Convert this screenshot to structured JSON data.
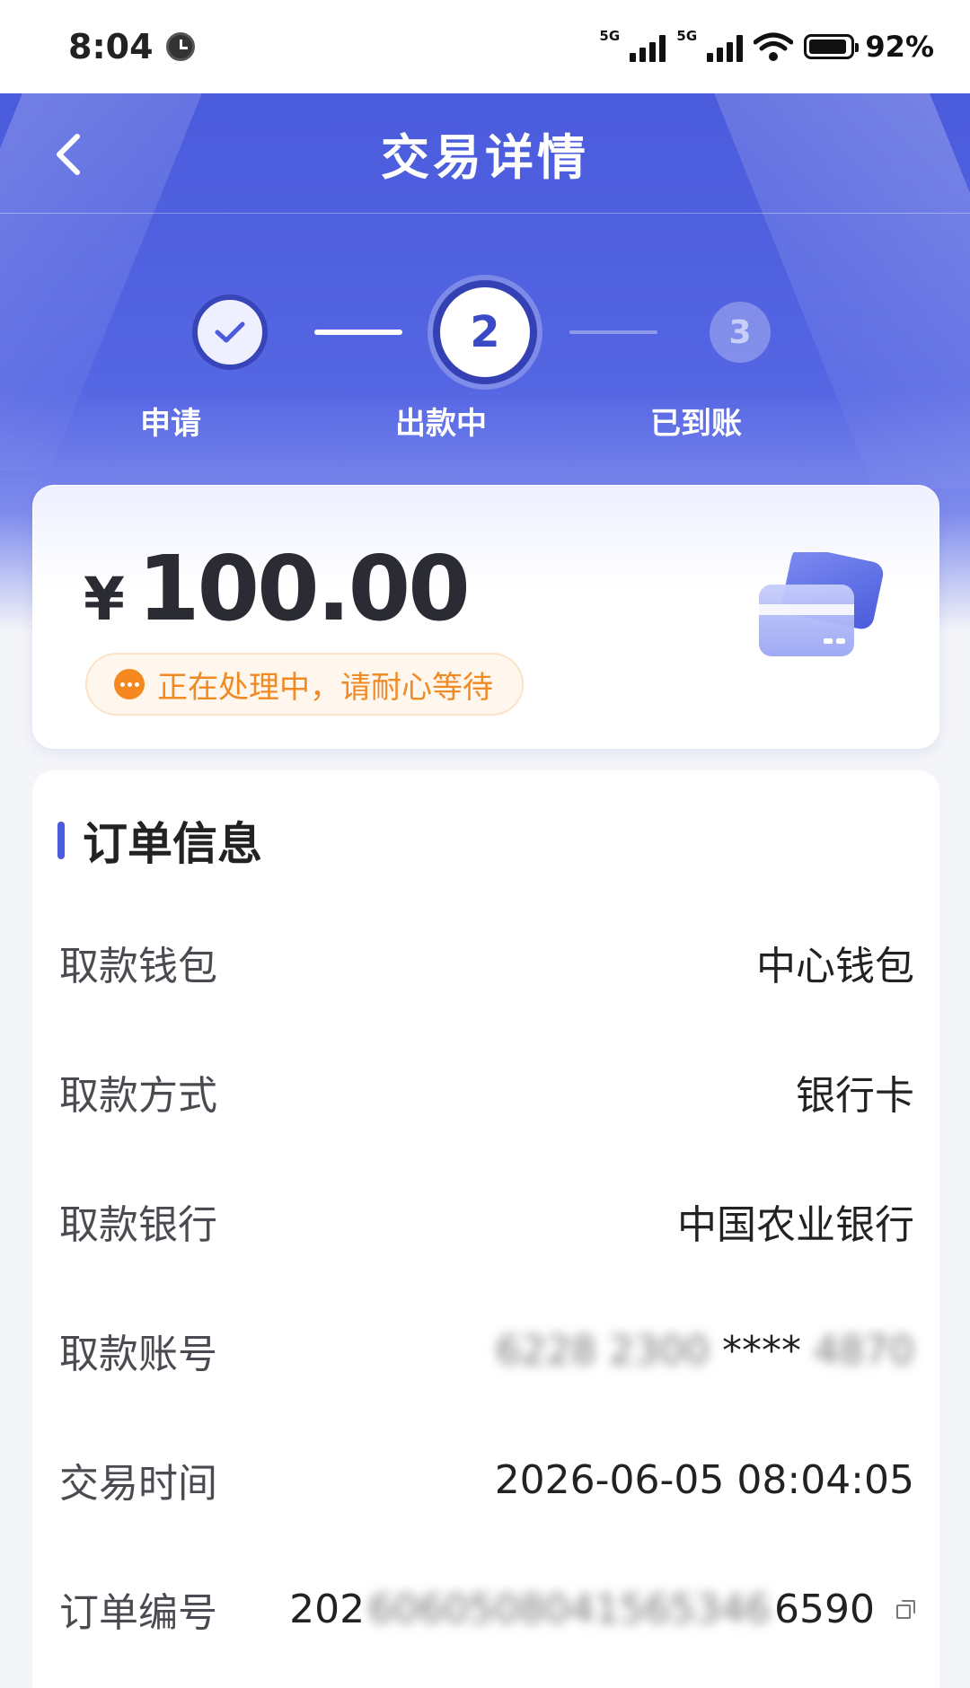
{
  "status_bar": {
    "time": "8:04",
    "network_1": "5G",
    "network_2": "5G",
    "battery": "92%"
  },
  "header": {
    "title": "交易详情"
  },
  "steps": [
    {
      "label": "申请",
      "state": "done"
    },
    {
      "label": "出款中",
      "state": "current",
      "number": "2"
    },
    {
      "label": "已到账",
      "state": "todo",
      "number": "3"
    }
  ],
  "amount_card": {
    "currency": "¥",
    "amount": "100.00",
    "status": "正在处理中，请耐心等待"
  },
  "order_info": {
    "title": "订单信息",
    "rows": [
      {
        "label": "取款钱包",
        "value": "中心钱包"
      },
      {
        "label": "取款方式",
        "value": "银行卡"
      },
      {
        "label": "取款银行",
        "value": "中国农业银行"
      },
      {
        "label": "取款账号",
        "value_a": "6228 2300",
        "value_mask": " **** ",
        "value_b": "4870"
      },
      {
        "label": "交易时间",
        "value": "2026-06-05 08:04:05"
      },
      {
        "label": "订单编号",
        "value_a": "202",
        "value_mask": "6060508041565346",
        "value_b": "6590"
      }
    ]
  },
  "colors": {
    "primary": "#4a5bdc",
    "warning": "#f08a24"
  },
  "icons": {
    "back": "chevron-left-icon",
    "done": "check-icon",
    "status": "more-dots-icon",
    "card": "bank-card-icon",
    "copy": "copy-icon"
  }
}
